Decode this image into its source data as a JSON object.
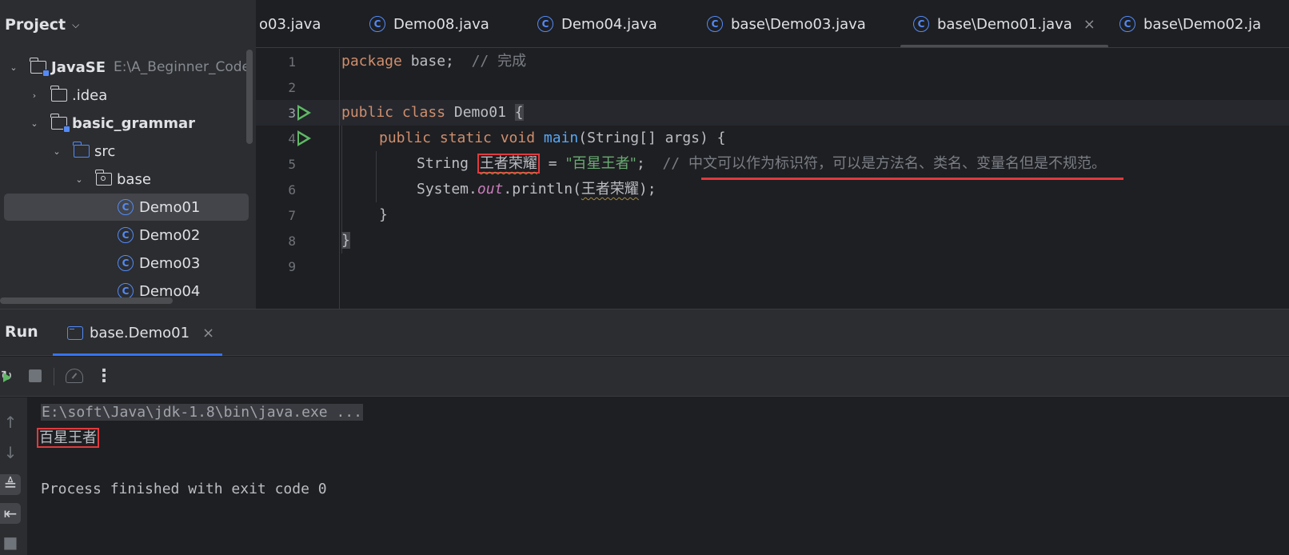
{
  "project_panel": {
    "title": "Project",
    "tree": [
      {
        "label": "JavaSE",
        "path": "E:\\A_Beginner_Code",
        "kind": "module",
        "expanded": true
      },
      {
        "label": ".idea",
        "kind": "folder",
        "expanded": false
      },
      {
        "label": "basic_grammar",
        "kind": "module",
        "expanded": true
      },
      {
        "label": "src",
        "kind": "source-folder",
        "expanded": true
      },
      {
        "label": "base",
        "kind": "package",
        "expanded": true
      },
      {
        "label": "Demo01",
        "kind": "class",
        "selected": true
      },
      {
        "label": "Demo02",
        "kind": "class"
      },
      {
        "label": "Demo03",
        "kind": "class"
      },
      {
        "label": "Demo04",
        "kind": "class"
      }
    ]
  },
  "editor_tabs": [
    {
      "label": "o03.java"
    },
    {
      "label": "Demo08.java"
    },
    {
      "label": "Demo04.java"
    },
    {
      "label": "base\\Demo03.java"
    },
    {
      "label": "base\\Demo01.java",
      "active": true,
      "close": "×"
    },
    {
      "label": "base\\Demo02.ja"
    }
  ],
  "editor": {
    "line_numbers": [
      "1",
      "2",
      "3",
      "4",
      "5",
      "6",
      "7",
      "8",
      "9"
    ],
    "current_line": 3,
    "code": {
      "l1_kw": "package",
      "l1_rest": " base;  ",
      "l1_comment": "// ",
      "l1_comment_cn": "完成",
      "l3_kw": "public class",
      "l3_name": " Demo01 ",
      "l3_brace": "{",
      "l4_kw": "public static void",
      "l4_fn": "main",
      "l4_rest": "(String[] args) {",
      "l5_type": "String ",
      "l5_var": "王者荣耀",
      "l5_eq": " = ",
      "l5_str": "\"百星王者\"",
      "l5_semi": ";  ",
      "l5_comment": "// ",
      "l5_comment_cn": "中文可以作为标识符，可以是方法名、类名、变量名但是不规范。",
      "l6_obj": "System.",
      "l6_field": "out",
      "l6_call": ".println(",
      "l6_arg": "王者荣耀",
      "l6_end": ");",
      "l7": "}",
      "l8": "}"
    }
  },
  "run_panel": {
    "title": "Run",
    "tab_label": "base.Demo01",
    "tab_close": "×",
    "toolbar": {
      "rerun": "rerun-icon",
      "stop": "stop-icon",
      "coverage": "coverage-icon",
      "more": "⋮"
    },
    "console": {
      "command": "E:\\soft\\Java\\jdk-1.8\\bin\\java.exe ...",
      "output": "百星王者",
      "finish": "Process finished with exit code 0"
    }
  },
  "colors": {
    "keyword": "#cf8e6d",
    "function": "#56a8f5",
    "string": "#6aab73",
    "comment": "#7a7e85",
    "annotation_red": "#e03a3e",
    "accent_blue": "#548af7"
  }
}
